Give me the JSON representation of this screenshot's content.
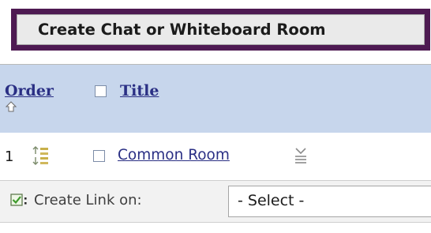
{
  "toolbar": {
    "create_label": "Create Chat or Whiteboard Room"
  },
  "table": {
    "columns": {
      "order": "Order",
      "title": "Title"
    },
    "rows": [
      {
        "order": "1",
        "title": "Common Room"
      }
    ]
  },
  "bulk_actions": {
    "create_link_label": "Create Link on:",
    "select_value": "- Select -"
  },
  "colors": {
    "button_border": "#4e1a52",
    "header_bg": "#c7d6ec",
    "link": "#2a2f84"
  }
}
